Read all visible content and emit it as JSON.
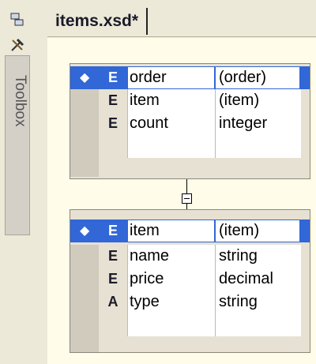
{
  "sidebar": {
    "server_icon": "server-explorer-icon",
    "tools_icon": "toolbox-icon",
    "toolbox_label": "Toolbox"
  },
  "tab": {
    "title": "items.xsd*"
  },
  "schema": {
    "order": {
      "header": {
        "type": "E",
        "name": "order",
        "value": "(order)"
      },
      "rows": [
        {
          "type": "E",
          "name": "item",
          "value": "(item)"
        },
        {
          "type": "E",
          "name": "count",
          "value": "integer"
        }
      ]
    },
    "item": {
      "header": {
        "type": "E",
        "name": "item",
        "value": "(item)"
      },
      "rows": [
        {
          "type": "E",
          "name": "name",
          "value": "string"
        },
        {
          "type": "E",
          "name": "price",
          "value": "decimal"
        },
        {
          "type": "A",
          "name": "type",
          "value": "string"
        }
      ]
    }
  },
  "colors": {
    "selection": "#3167d6",
    "canvas": "#fffde9",
    "chrome": "#ece9d8"
  }
}
